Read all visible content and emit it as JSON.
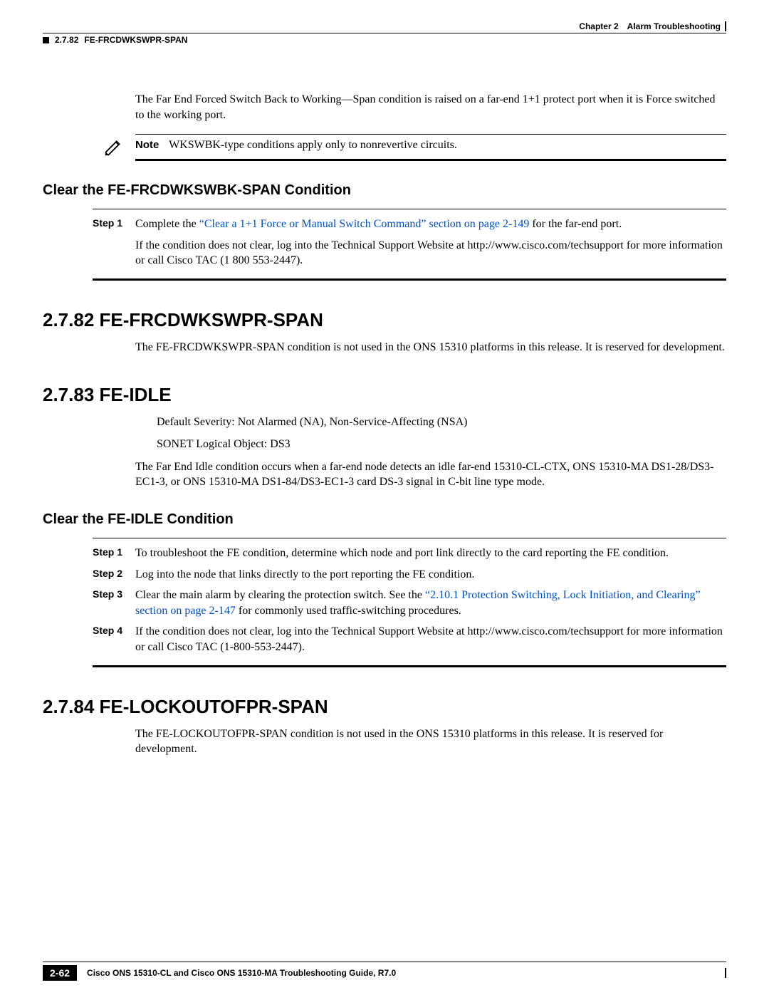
{
  "header": {
    "chapter": "Chapter 2",
    "title": "Alarm Troubleshooting",
    "section_no": "2.7.82",
    "section_name": "FE-FRCDWKSWPR-SPAN"
  },
  "intro_para": "The Far End Forced Switch Back to Working—Span condition is raised on a far-end 1+1 protect port when it is Force switched to the working port.",
  "note": {
    "label": "Note",
    "text": "WKSWBK-type conditions apply only to nonrevertive circuits."
  },
  "clear_wkswbk": {
    "heading": "Clear the FE-FRCDWKSWBK-SPAN Condition",
    "step1_label": "Step 1",
    "step1_pre": "Complete the ",
    "step1_link": "“Clear a 1+1 Force or Manual Switch Command” section on page 2-149",
    "step1_post": " for the far-end port.",
    "follow": "If the condition does not clear, log into the Technical Support Website at http://www.cisco.com/techsupport for more information or call Cisco TAC (1 800 553-2447)."
  },
  "s2782": {
    "heading": "2.7.82  FE-FRCDWKSWPR-SPAN",
    "para": "The FE-FRCDWKSWPR-SPAN condition is not used in the ONS 15310 platforms in this release. It is reserved for development."
  },
  "s2783": {
    "heading": "2.7.83  FE-IDLE",
    "severity": "Default Severity: Not Alarmed (NA), Non-Service-Affecting (NSA)",
    "object": "SONET Logical Object: DS3",
    "para": "The Far End Idle condition occurs when a far-end node detects an idle far-end 15310-CL-CTX, ONS 15310-MA DS1-28/DS3-EC1-3, or ONS 15310-MA DS1-84/DS3-EC1-3 card DS-3 signal in C-bit line type mode."
  },
  "clear_idle": {
    "heading": "Clear the FE-IDLE Condition",
    "steps": [
      {
        "label": "Step 1",
        "pre": "To troubleshoot the FE condition, determine which node and port link directly to the card reporting the FE condition.",
        "link": "",
        "post": ""
      },
      {
        "label": "Step 2",
        "pre": "Log into the node that links directly to the port reporting the FE condition.",
        "link": "",
        "post": ""
      },
      {
        "label": "Step 3",
        "pre": "Clear the main alarm by clearing the protection switch. See the ",
        "link": "“2.10.1  Protection Switching, Lock Initiation, and Clearing” section on page 2-147",
        "post": " for commonly used traffic-switching procedures."
      },
      {
        "label": "Step 4",
        "pre": "If the condition does not clear, log into the Technical Support Website at http://www.cisco.com/techsupport for more information or call Cisco TAC (1-800-553-2447).",
        "link": "",
        "post": ""
      }
    ]
  },
  "s2784": {
    "heading": "2.7.84  FE-LOCKOUTOFPR-SPAN",
    "para": "The FE-LOCKOUTOFPR-SPAN condition is not used in the ONS 15310 platforms in this release. It is reserved for development."
  },
  "footer": {
    "page": "2-62",
    "title": "Cisco ONS 15310-CL and Cisco ONS 15310-MA Troubleshooting Guide, R7.0"
  }
}
